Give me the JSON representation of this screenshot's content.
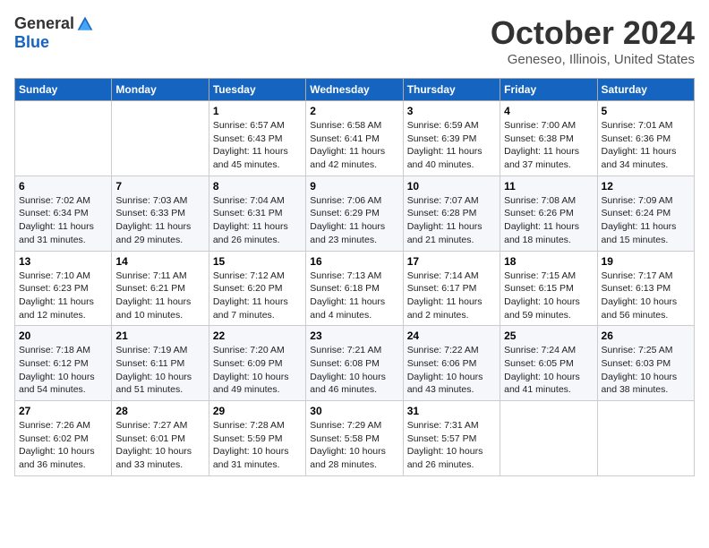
{
  "header": {
    "logo_general": "General",
    "logo_blue": "Blue",
    "title": "October 2024",
    "location": "Geneseo, Illinois, United States"
  },
  "weekdays": [
    "Sunday",
    "Monday",
    "Tuesday",
    "Wednesday",
    "Thursday",
    "Friday",
    "Saturday"
  ],
  "weeks": [
    [
      {
        "day": "",
        "sunrise": "",
        "sunset": "",
        "daylight": ""
      },
      {
        "day": "",
        "sunrise": "",
        "sunset": "",
        "daylight": ""
      },
      {
        "day": "1",
        "sunrise": "Sunrise: 6:57 AM",
        "sunset": "Sunset: 6:43 PM",
        "daylight": "Daylight: 11 hours and 45 minutes."
      },
      {
        "day": "2",
        "sunrise": "Sunrise: 6:58 AM",
        "sunset": "Sunset: 6:41 PM",
        "daylight": "Daylight: 11 hours and 42 minutes."
      },
      {
        "day": "3",
        "sunrise": "Sunrise: 6:59 AM",
        "sunset": "Sunset: 6:39 PM",
        "daylight": "Daylight: 11 hours and 40 minutes."
      },
      {
        "day": "4",
        "sunrise": "Sunrise: 7:00 AM",
        "sunset": "Sunset: 6:38 PM",
        "daylight": "Daylight: 11 hours and 37 minutes."
      },
      {
        "day": "5",
        "sunrise": "Sunrise: 7:01 AM",
        "sunset": "Sunset: 6:36 PM",
        "daylight": "Daylight: 11 hours and 34 minutes."
      }
    ],
    [
      {
        "day": "6",
        "sunrise": "Sunrise: 7:02 AM",
        "sunset": "Sunset: 6:34 PM",
        "daylight": "Daylight: 11 hours and 31 minutes."
      },
      {
        "day": "7",
        "sunrise": "Sunrise: 7:03 AM",
        "sunset": "Sunset: 6:33 PM",
        "daylight": "Daylight: 11 hours and 29 minutes."
      },
      {
        "day": "8",
        "sunrise": "Sunrise: 7:04 AM",
        "sunset": "Sunset: 6:31 PM",
        "daylight": "Daylight: 11 hours and 26 minutes."
      },
      {
        "day": "9",
        "sunrise": "Sunrise: 7:06 AM",
        "sunset": "Sunset: 6:29 PM",
        "daylight": "Daylight: 11 hours and 23 minutes."
      },
      {
        "day": "10",
        "sunrise": "Sunrise: 7:07 AM",
        "sunset": "Sunset: 6:28 PM",
        "daylight": "Daylight: 11 hours and 21 minutes."
      },
      {
        "day": "11",
        "sunrise": "Sunrise: 7:08 AM",
        "sunset": "Sunset: 6:26 PM",
        "daylight": "Daylight: 11 hours and 18 minutes."
      },
      {
        "day": "12",
        "sunrise": "Sunrise: 7:09 AM",
        "sunset": "Sunset: 6:24 PM",
        "daylight": "Daylight: 11 hours and 15 minutes."
      }
    ],
    [
      {
        "day": "13",
        "sunrise": "Sunrise: 7:10 AM",
        "sunset": "Sunset: 6:23 PM",
        "daylight": "Daylight: 11 hours and 12 minutes."
      },
      {
        "day": "14",
        "sunrise": "Sunrise: 7:11 AM",
        "sunset": "Sunset: 6:21 PM",
        "daylight": "Daylight: 11 hours and 10 minutes."
      },
      {
        "day": "15",
        "sunrise": "Sunrise: 7:12 AM",
        "sunset": "Sunset: 6:20 PM",
        "daylight": "Daylight: 11 hours and 7 minutes."
      },
      {
        "day": "16",
        "sunrise": "Sunrise: 7:13 AM",
        "sunset": "Sunset: 6:18 PM",
        "daylight": "Daylight: 11 hours and 4 minutes."
      },
      {
        "day": "17",
        "sunrise": "Sunrise: 7:14 AM",
        "sunset": "Sunset: 6:17 PM",
        "daylight": "Daylight: 11 hours and 2 minutes."
      },
      {
        "day": "18",
        "sunrise": "Sunrise: 7:15 AM",
        "sunset": "Sunset: 6:15 PM",
        "daylight": "Daylight: 10 hours and 59 minutes."
      },
      {
        "day": "19",
        "sunrise": "Sunrise: 7:17 AM",
        "sunset": "Sunset: 6:13 PM",
        "daylight": "Daylight: 10 hours and 56 minutes."
      }
    ],
    [
      {
        "day": "20",
        "sunrise": "Sunrise: 7:18 AM",
        "sunset": "Sunset: 6:12 PM",
        "daylight": "Daylight: 10 hours and 54 minutes."
      },
      {
        "day": "21",
        "sunrise": "Sunrise: 7:19 AM",
        "sunset": "Sunset: 6:11 PM",
        "daylight": "Daylight: 10 hours and 51 minutes."
      },
      {
        "day": "22",
        "sunrise": "Sunrise: 7:20 AM",
        "sunset": "Sunset: 6:09 PM",
        "daylight": "Daylight: 10 hours and 49 minutes."
      },
      {
        "day": "23",
        "sunrise": "Sunrise: 7:21 AM",
        "sunset": "Sunset: 6:08 PM",
        "daylight": "Daylight: 10 hours and 46 minutes."
      },
      {
        "day": "24",
        "sunrise": "Sunrise: 7:22 AM",
        "sunset": "Sunset: 6:06 PM",
        "daylight": "Daylight: 10 hours and 43 minutes."
      },
      {
        "day": "25",
        "sunrise": "Sunrise: 7:24 AM",
        "sunset": "Sunset: 6:05 PM",
        "daylight": "Daylight: 10 hours and 41 minutes."
      },
      {
        "day": "26",
        "sunrise": "Sunrise: 7:25 AM",
        "sunset": "Sunset: 6:03 PM",
        "daylight": "Daylight: 10 hours and 38 minutes."
      }
    ],
    [
      {
        "day": "27",
        "sunrise": "Sunrise: 7:26 AM",
        "sunset": "Sunset: 6:02 PM",
        "daylight": "Daylight: 10 hours and 36 minutes."
      },
      {
        "day": "28",
        "sunrise": "Sunrise: 7:27 AM",
        "sunset": "Sunset: 6:01 PM",
        "daylight": "Daylight: 10 hours and 33 minutes."
      },
      {
        "day": "29",
        "sunrise": "Sunrise: 7:28 AM",
        "sunset": "Sunset: 5:59 PM",
        "daylight": "Daylight: 10 hours and 31 minutes."
      },
      {
        "day": "30",
        "sunrise": "Sunrise: 7:29 AM",
        "sunset": "Sunset: 5:58 PM",
        "daylight": "Daylight: 10 hours and 28 minutes."
      },
      {
        "day": "31",
        "sunrise": "Sunrise: 7:31 AM",
        "sunset": "Sunset: 5:57 PM",
        "daylight": "Daylight: 10 hours and 26 minutes."
      },
      {
        "day": "",
        "sunrise": "",
        "sunset": "",
        "daylight": ""
      },
      {
        "day": "",
        "sunrise": "",
        "sunset": "",
        "daylight": ""
      }
    ]
  ]
}
